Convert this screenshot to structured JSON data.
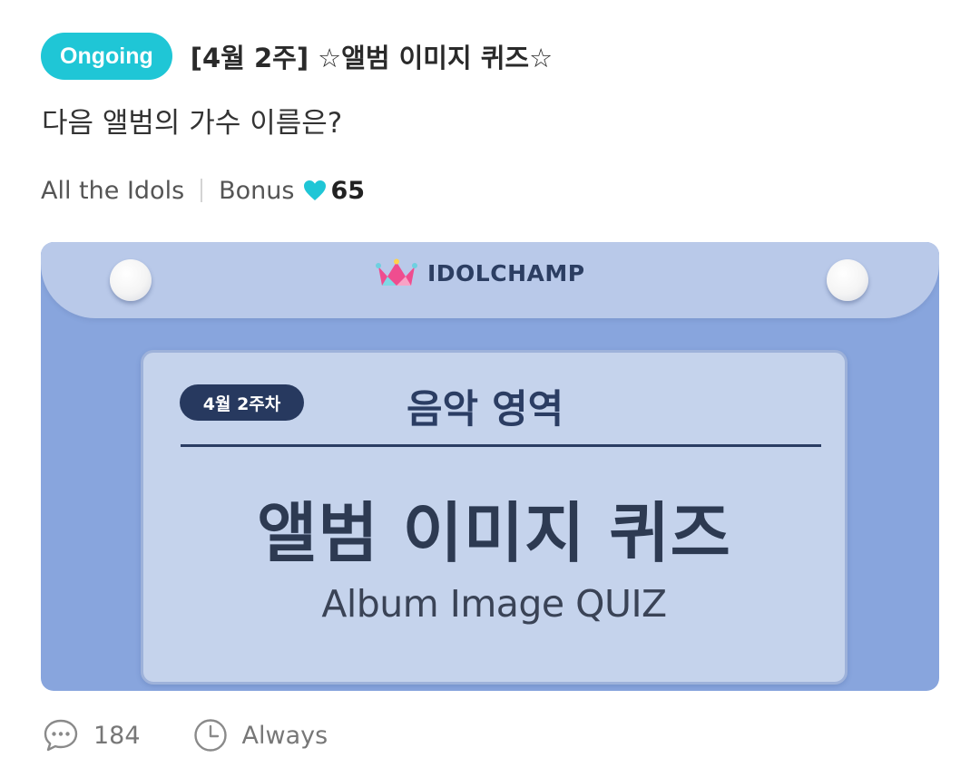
{
  "post": {
    "status": "Ongoing",
    "title": "[4월 2주] ☆앨범 이미지 퀴즈☆",
    "question": "다음 앨범의 가수 이름은?"
  },
  "meta": {
    "category": "All the Idols",
    "bonus_label": "Bonus",
    "bonus_points": "65"
  },
  "banner": {
    "brand": "IDOLCHAMP",
    "week": "4월 2주차",
    "category": "음악 영역",
    "title_ko": "앨범 이미지 퀴즈",
    "title_en": "Album Image QUIZ"
  },
  "footer": {
    "comment_count": "184",
    "duration": "Always"
  },
  "colors": {
    "accent": "#1fc6d6",
    "banner_bg": "#88a5dd",
    "card_bg": "#c5d3ec",
    "navy": "#27395f"
  },
  "icons": {
    "heart": "heart-icon",
    "crown": "crown-icon",
    "comment": "comment-icon",
    "clock": "clock-icon"
  }
}
